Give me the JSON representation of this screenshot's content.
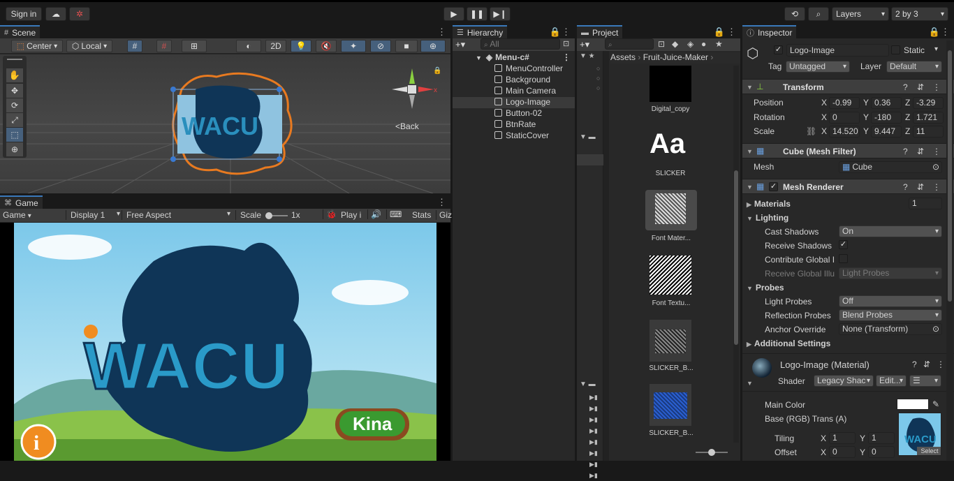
{
  "toolbar": {
    "sign_in": "Sign in",
    "layers": "Layers",
    "layout": "2 by 3",
    "icons": [
      "cloud-icon",
      "collab-icon",
      "play-icon",
      "pause-icon",
      "step-icon",
      "history-icon",
      "search-icon"
    ]
  },
  "scene": {
    "tab": "Scene",
    "pivot": "Center",
    "space": "Local",
    "mode_2d": "2D",
    "back_label": "Back",
    "gizmo_axis": "x"
  },
  "game": {
    "tab": "Game",
    "mode": "Game",
    "display": "Display 1",
    "aspect": "Free Aspect",
    "scale_label": "Scale",
    "scale_value": "1x",
    "play": "Play i",
    "stats": "Stats",
    "gizmos": "Giz",
    "logo": "WACU",
    "button": "Kina",
    "info": "i"
  },
  "hierarchy": {
    "tab": "Hierarchy",
    "search_placeholder": "All",
    "root": "Menu-c#",
    "items": [
      "MenuController",
      "Background",
      "Main Camera",
      "Logo-Image",
      "Button-02",
      "BtnRate",
      "StaticCover"
    ]
  },
  "project": {
    "tab": "Project",
    "breadcrumb": [
      "Assets",
      "Fruit-Juice-Maker"
    ],
    "assets": [
      {
        "label": "Digital_copy"
      },
      {
        "label": "SLICKER",
        "glyph": "Aa"
      },
      {
        "label": "Font Mater..."
      },
      {
        "label": "Font Textu..."
      },
      {
        "label": "SLICKER_B..."
      },
      {
        "label": "SLICKER_B..."
      }
    ]
  },
  "inspector": {
    "tab": "Inspector",
    "object_name": "Logo-Image",
    "static_label": "Static",
    "tag_label": "Tag",
    "tag_value": "Untagged",
    "layer_label": "Layer",
    "layer_value": "Default",
    "transform": {
      "title": "Transform",
      "position_label": "Position",
      "rotation_label": "Rotation",
      "scale_label": "Scale",
      "position": {
        "x": "-0.99",
        "y": "0.36",
        "z": "-3.29"
      },
      "rotation": {
        "x": "0",
        "y": "-180",
        "z": "1.721"
      },
      "scale": {
        "x": "14.520",
        "y": "9.447",
        "z": "11"
      }
    },
    "mesh_filter": {
      "title": "Cube (Mesh Filter)",
      "mesh_label": "Mesh",
      "mesh_value": "Cube"
    },
    "mesh_renderer": {
      "title": "Mesh Renderer",
      "materials_label": "Materials",
      "materials_count": "1",
      "lighting": "Lighting",
      "cast_shadows_label": "Cast Shadows",
      "cast_shadows_value": "On",
      "receive_shadows_label": "Receive Shadows",
      "contribute_gi_label": "Contribute Global I",
      "receive_gi_label": "Receive Global Illu",
      "receive_gi_value": "Light Probes",
      "probes": "Probes",
      "light_probes_label": "Light Probes",
      "light_probes_value": "Off",
      "reflection_probes_label": "Reflection Probes",
      "reflection_probes_value": "Blend Probes",
      "anchor_override_label": "Anchor Override",
      "anchor_override_value": "None (Transform)",
      "additional_settings": "Additional Settings"
    },
    "material": {
      "title": "Logo-Image (Material)",
      "shader_label": "Shader",
      "shader_value": "Legacy Shac",
      "edit_label": "Edit...",
      "main_color_label": "Main Color",
      "base_label": "Base (RGB) Trans (A)",
      "tiling_label": "Tiling",
      "offset_label": "Offset",
      "tiling": {
        "x": "1",
        "y": "1"
      },
      "offset": {
        "x": "0",
        "y": "0"
      },
      "select_label": "Select"
    }
  }
}
